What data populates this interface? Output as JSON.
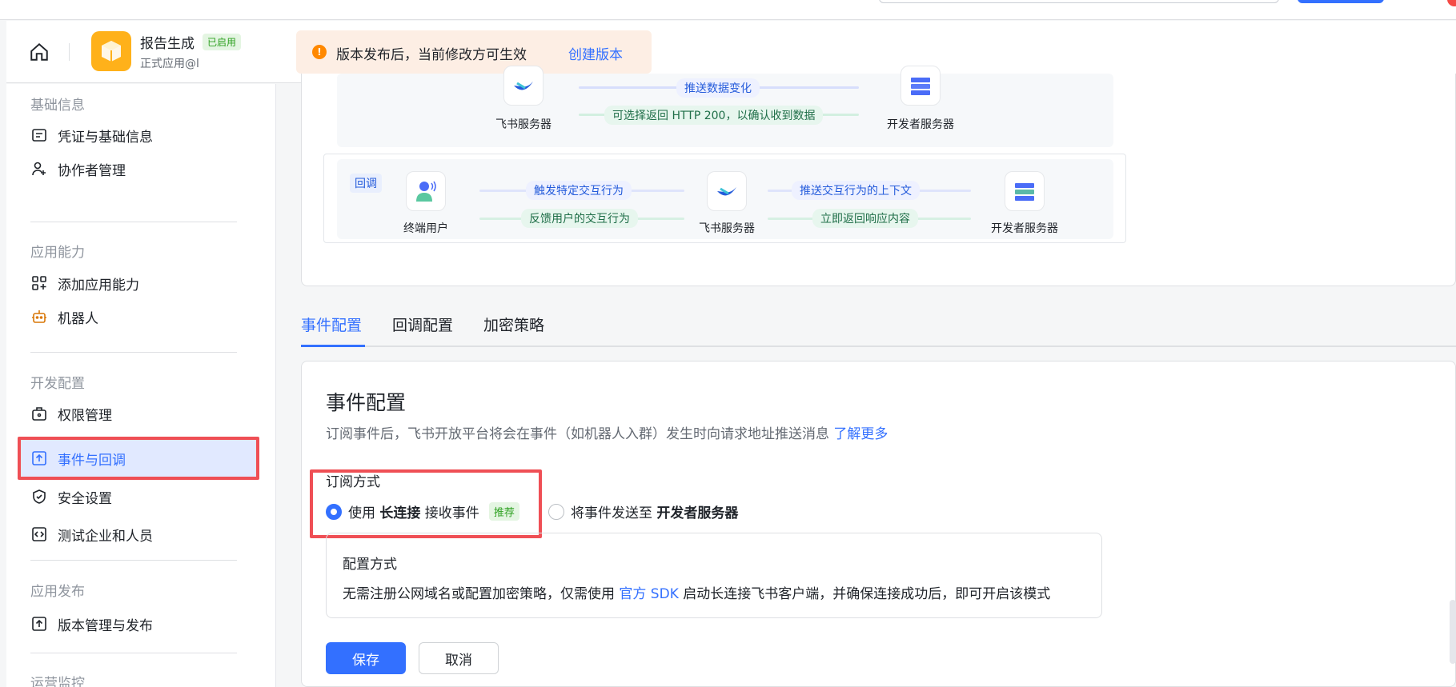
{
  "header": {
    "app_name": "报告生成",
    "app_status": "已启用",
    "app_subtitle": "正式应用@l",
    "notice_text": "版本发布后，当前修改方可生效",
    "notice_link": "创建版本"
  },
  "sidebar": {
    "sections": [
      {
        "title": "基础信息",
        "items": [
          "凭证与基础信息",
          "协作者管理"
        ]
      },
      {
        "title": "应用能力",
        "items": [
          "添加应用能力",
          "机器人"
        ]
      },
      {
        "title": "开发配置",
        "items": [
          "权限管理",
          "事件与回调",
          "安全设置",
          "测试企业和人员"
        ]
      },
      {
        "title": "应用发布",
        "items": [
          "版本管理与发布"
        ]
      },
      {
        "title": "运营监控",
        "items": []
      }
    ],
    "active_item": "事件与回调"
  },
  "flow": {
    "event_row": {
      "node_feishu": "飞书服务器",
      "node_dev": "开发者服务器",
      "arrow_push": "推送数据变化",
      "arrow_return": "可选择返回 HTTP 200，以确认收到数据"
    },
    "callback_row": {
      "tag": "回调",
      "node_user": "终端用户",
      "node_feishu": "飞书服务器",
      "node_dev": "开发者服务器",
      "arrow_trigger": "触发特定交互行为",
      "arrow_feedback": "反馈用户的交互行为",
      "arrow_push_ctx": "推送交互行为的上下文",
      "arrow_reply": "立即返回响应内容"
    }
  },
  "tabs": [
    "事件配置",
    "回调配置",
    "加密策略"
  ],
  "config": {
    "title": "事件配置",
    "desc": "订阅事件后，飞书开放平台将会在事件（如机器人入群）发生时向请求地址推送消息",
    "desc_link": "了解更多",
    "sub_label": "订阅方式",
    "option1_pre": "使用 ",
    "option1_bold": "长连接",
    "option1_post": " 接收事件",
    "option1_badge": "推荐",
    "option2_pre": "将事件发送至 ",
    "option2_bold": "开发者服务器",
    "mode_title": "配置方式",
    "mode_desc_pre": "无需注册公网域名或配置加密策略，仅需使用 ",
    "mode_desc_link": "官方 SDK",
    "mode_desc_post": " 启动长连接飞书客户端，并确保连接成功后，即可开启该模式",
    "save": "保存",
    "cancel": "取消"
  },
  "colors": {
    "accent": "#3370ff",
    "highlight_border": "#ef4f55",
    "success": "#2ea121"
  }
}
